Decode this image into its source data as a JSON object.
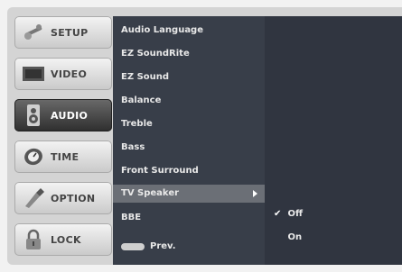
{
  "sidebar": {
    "items": [
      {
        "label": "SETUP",
        "icon": "setup-icon",
        "active": false
      },
      {
        "label": "VIDEO",
        "icon": "video-icon",
        "active": false
      },
      {
        "label": "AUDIO",
        "icon": "audio-icon",
        "active": true
      },
      {
        "label": "TIME",
        "icon": "time-icon",
        "active": false
      },
      {
        "label": "OPTION",
        "icon": "option-icon",
        "active": false
      },
      {
        "label": "LOCK",
        "icon": "lock-icon",
        "active": false
      }
    ]
  },
  "audio_menu": {
    "items": [
      "Audio Language",
      "EZ SoundRite",
      "EZ Sound",
      "Balance",
      "Treble",
      "Bass",
      "Front Surround",
      "TV Speaker",
      "BBE"
    ],
    "selected_index": 7,
    "footer": {
      "button_icon": "menu-button-icon",
      "label": "Prev."
    }
  },
  "tv_speaker_options": {
    "items": [
      {
        "label": "Off",
        "checked": true
      },
      {
        "label": "On",
        "checked": false
      }
    ]
  },
  "colors": {
    "menu_bg": "#383e49",
    "submenu_bg": "#303540",
    "selected_bg": "#6b6f76",
    "frame_bg": "#d4d4d4"
  }
}
